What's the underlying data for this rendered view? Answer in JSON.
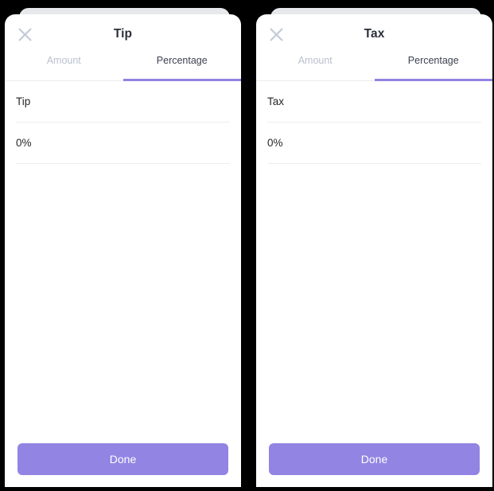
{
  "theme": {
    "background": "#000000",
    "sheet_background": "#ffffff",
    "back_card": "#e7e8ec",
    "accent": "#9184e3",
    "title_color": "#2b2f3a",
    "tab_active_color": "#3c4150",
    "tab_inactive_color": "#b9c0cf",
    "close_icon_color": "#c3cbd9",
    "divider_color": "#eceded",
    "field_text_color": "#262626",
    "done_label_color": "#ffffff"
  },
  "panels": [
    {
      "id": "tip-panel",
      "header": {
        "title": "Tip",
        "close_icon": "close-icon"
      },
      "tabs": [
        {
          "label": "Amount",
          "active": false
        },
        {
          "label": "Percentage",
          "active": true
        }
      ],
      "fields": [
        {
          "name": "label-field",
          "value": "Tip",
          "placeholder": "Tip"
        },
        {
          "name": "percentage-field",
          "value": "0%",
          "placeholder": "0%"
        }
      ],
      "footer": {
        "done_label": "Done"
      }
    },
    {
      "id": "tax-panel",
      "header": {
        "title": "Tax",
        "close_icon": "close-icon"
      },
      "tabs": [
        {
          "label": "Amount",
          "active": false
        },
        {
          "label": "Percentage",
          "active": true
        }
      ],
      "fields": [
        {
          "name": "label-field",
          "value": "Tax",
          "placeholder": "Tax"
        },
        {
          "name": "percentage-field",
          "value": "0%",
          "placeholder": "0%"
        }
      ],
      "footer": {
        "done_label": "Done"
      }
    }
  ]
}
